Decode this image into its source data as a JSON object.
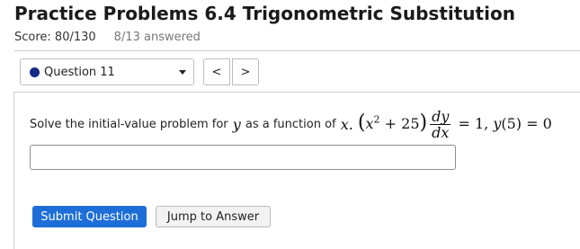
{
  "header": {
    "title": "Practice Problems 6.4 Trigonometric Substitution",
    "score": "Score: 80/130",
    "answered": "8/13 answered"
  },
  "question_nav": {
    "current": "Question 11",
    "prev_symbol": "<",
    "next_symbol": ">"
  },
  "problem": {
    "intro": "Solve the initial-value problem for",
    "y": "y",
    "as_function_of": "as a function of",
    "x": "x.",
    "eq_open": "(",
    "eq_x": "x",
    "eq_exp": "2",
    "eq_plus": "+ 25",
    "eq_close": ")",
    "frac_num": "dy",
    "frac_den": "dx",
    "eq_rest_1": "= 1, ",
    "eq_y": "y",
    "eq_rest_2": "(5) = 0"
  },
  "answer": {
    "value": "",
    "placeholder": ""
  },
  "buttons": {
    "submit": "Submit Question",
    "jump": "Jump to Answer"
  },
  "colors": {
    "accent": "#1d6ed8",
    "status_dot": "#142a87"
  }
}
